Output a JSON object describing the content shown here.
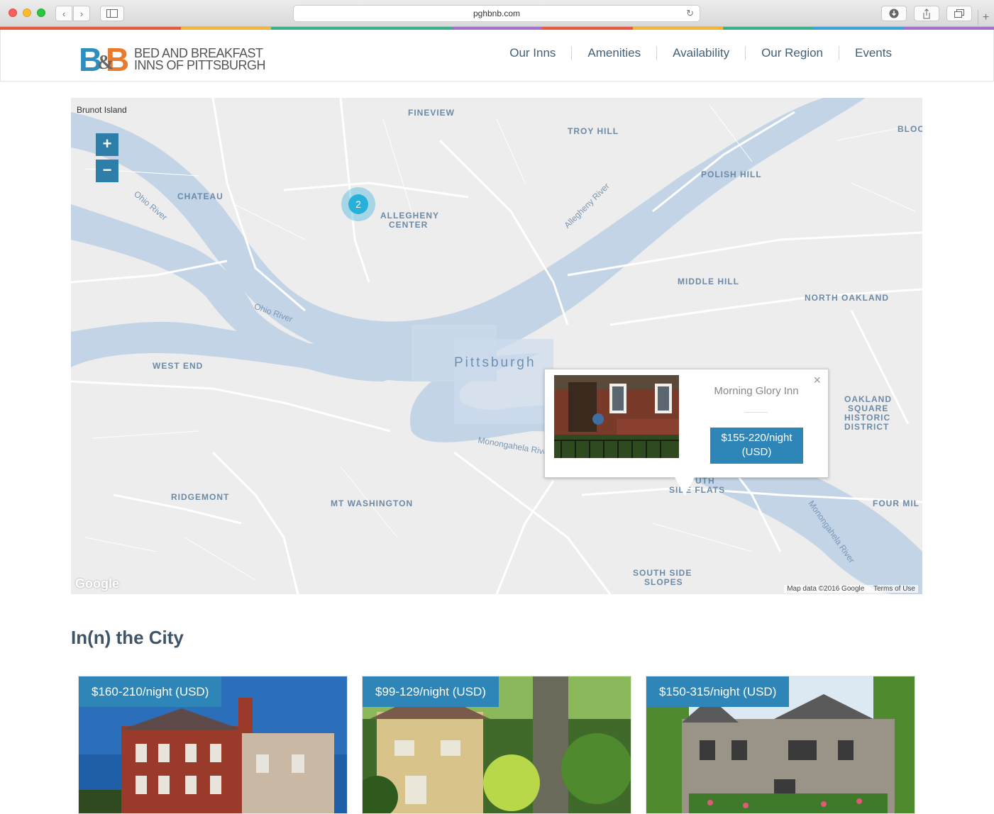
{
  "browser": {
    "url": "pghbnb.com",
    "nav_back": "‹",
    "nav_forward": "›"
  },
  "rainbow_colors": [
    "#e8573f",
    "#e8573f",
    "#f3b63a",
    "#3ab08a",
    "#3ab08a",
    "#a56fcf",
    "#e8573f",
    "#f3b63a",
    "#3ab08a",
    "#3aa3d9",
    "#a56fcf"
  ],
  "logo": {
    "mark_left": "B",
    "mark_amp": "&",
    "mark_right": "B",
    "line1": "BED AND BREAKFAST",
    "line2": "INNS OF PITTSBURGH"
  },
  "nav": {
    "items": [
      "Our Inns",
      "Amenities",
      "Availability",
      "Our Region",
      "Events"
    ]
  },
  "map": {
    "zoom_in": "+",
    "zoom_out": "−",
    "cluster_count": "2",
    "labels": {
      "brunot": "Brunot Island",
      "fineview": "FINEVIEW",
      "troy_hill": "TROY HILL",
      "chateau": "CHATEAU",
      "allegheny_center": "ALLEGHENY",
      "allegheny_center2": "CENTER",
      "polish_hill": "POLISH HILL",
      "middle_hill": "MIDDLE HILL",
      "north_oakland": "NORTH OAKLAND",
      "pittsburgh": "Pittsburgh",
      "west_end": "WEST END",
      "oakland_square": "OAKLAND",
      "oakland_square2": "SQUARE",
      "oakland_square3": "HISTORIC",
      "oakland_square4": "DISTRICT",
      "ridgemont": "RIDGEMONT",
      "mt_washington": "MT WASHINGTON",
      "south_side_flats": "UTH",
      "south_side_flats2": "SIDE FLATS",
      "south_side_slopes": "SOUTH SIDE",
      "south_side_slopes2": "SLOPES",
      "four_mile": "FOUR MIL",
      "bloo": "BLOO",
      "ohio_river": "Ohio River",
      "ohio_river2": "Ohio River",
      "allegheny_river": "Allegheny River",
      "monongahela": "Monongahela Rive",
      "monongahela2": "Monongahela River"
    },
    "google": "Google",
    "map_data": "Map data ©2016 Google",
    "terms": "Terms of Use"
  },
  "infowindow": {
    "title": "Morning Glory Inn",
    "price": "$155-220/night (USD)",
    "close": "×"
  },
  "section": {
    "title": "In(n) the City"
  },
  "cards": [
    {
      "price": "$160-210/night (USD)"
    },
    {
      "price": "$99-129/night (USD)"
    },
    {
      "price": "$150-315/night (USD)"
    }
  ]
}
